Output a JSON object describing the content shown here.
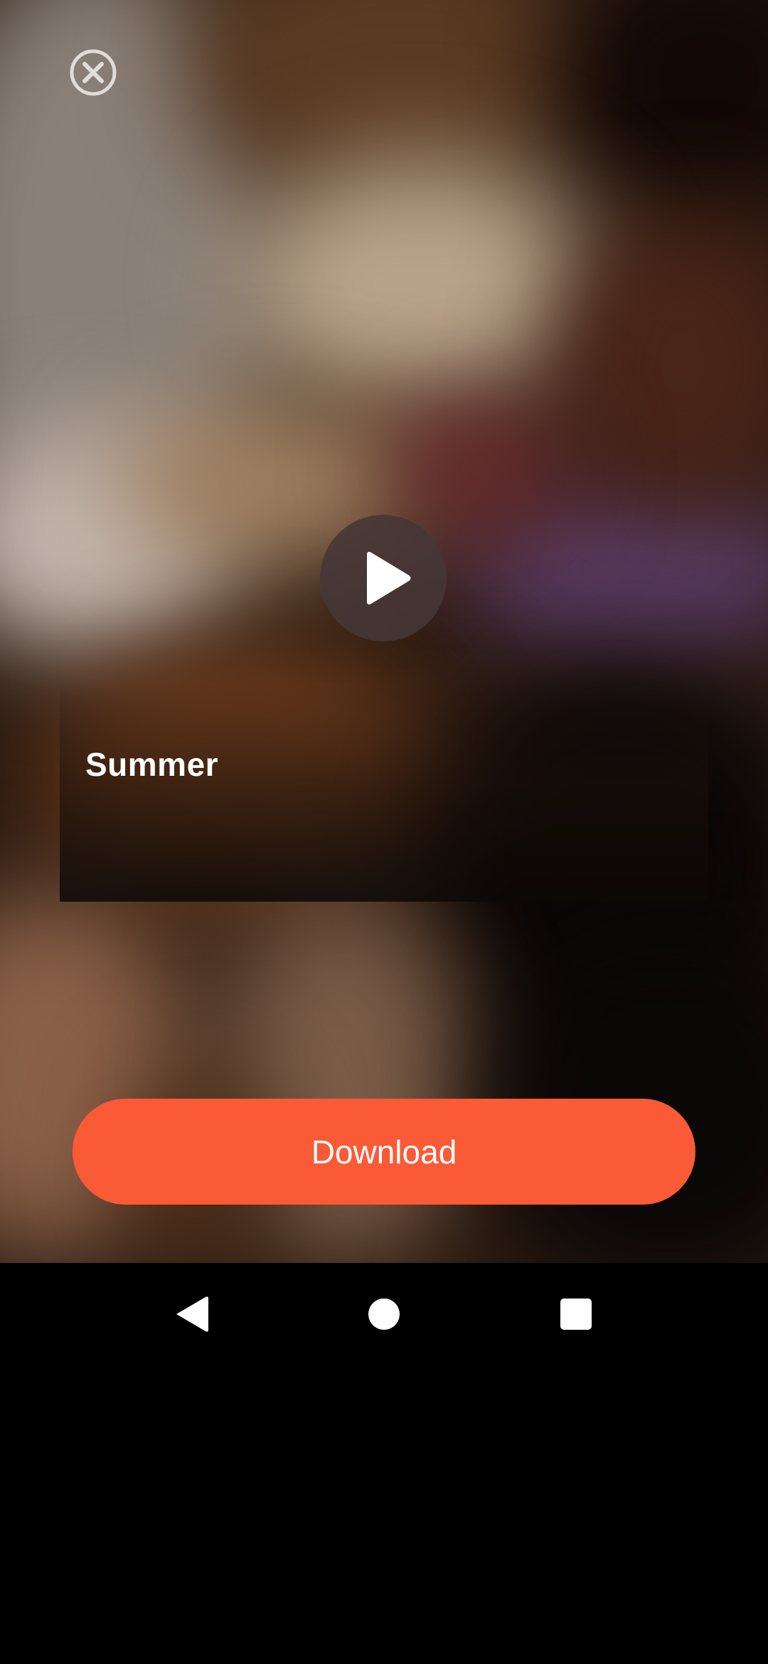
{
  "preview": {
    "title": "Summer"
  },
  "actions": {
    "download_label": "Download"
  },
  "icons": {
    "close": "close-circle-icon",
    "play": "play-icon",
    "nav_back": "triangle-back-icon",
    "nav_home": "circle-home-icon",
    "nav_recents": "square-recents-icon"
  },
  "colors": {
    "accent": "#fa5a35",
    "nav_bar": "#000000",
    "text": "#ffffff"
  }
}
